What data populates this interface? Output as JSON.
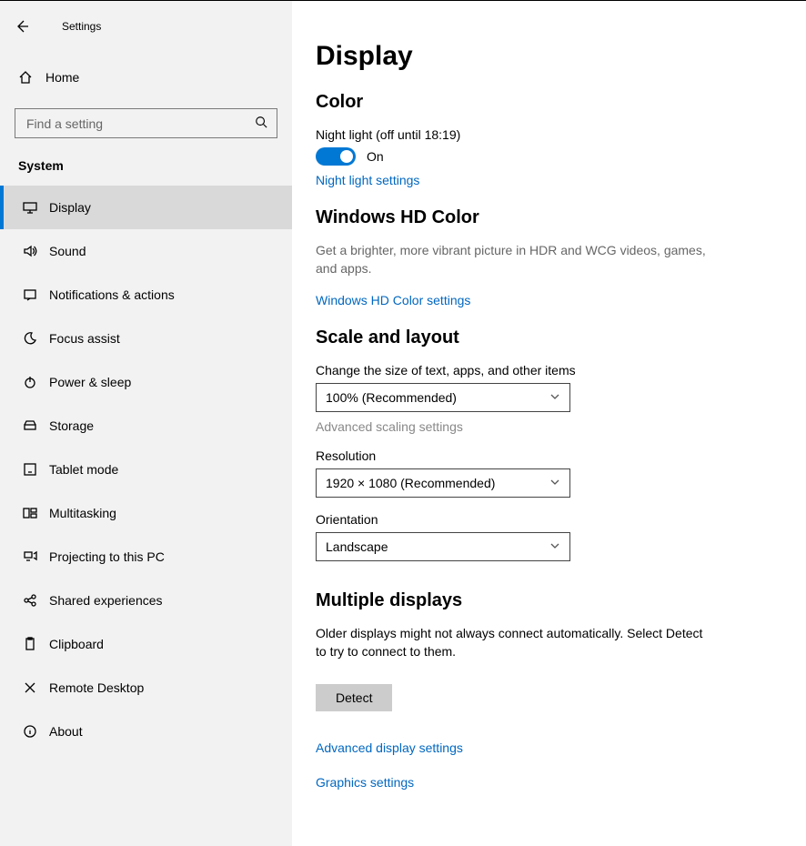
{
  "header": {
    "title": "Settings",
    "home": "Home",
    "search_placeholder": "Find a setting",
    "group": "System"
  },
  "nav": [
    {
      "label": "Display",
      "icon": "monitor"
    },
    {
      "label": "Sound",
      "icon": "sound"
    },
    {
      "label": "Notifications & actions",
      "icon": "notify"
    },
    {
      "label": "Focus assist",
      "icon": "moon"
    },
    {
      "label": "Power & sleep",
      "icon": "power"
    },
    {
      "label": "Storage",
      "icon": "storage"
    },
    {
      "label": "Tablet mode",
      "icon": "tablet"
    },
    {
      "label": "Multitasking",
      "icon": "multitask"
    },
    {
      "label": "Projecting to this PC",
      "icon": "project"
    },
    {
      "label": "Shared experiences",
      "icon": "shared"
    },
    {
      "label": "Clipboard",
      "icon": "clipboard"
    },
    {
      "label": "Remote Desktop",
      "icon": "remote"
    },
    {
      "label": "About",
      "icon": "about"
    }
  ],
  "page": {
    "title": "Display",
    "color": {
      "heading": "Color",
      "night_label": "Night light (off until 18:19)",
      "toggle_state": "On",
      "link": "Night light settings"
    },
    "hd": {
      "heading": "Windows HD Color",
      "desc": "Get a brighter, more vibrant picture in HDR and WCG videos, games, and apps.",
      "link": "Windows HD Color settings"
    },
    "scale": {
      "heading": "Scale and layout",
      "size_label": "Change the size of text, apps, and other items",
      "size_value": "100% (Recommended)",
      "adv_link": "Advanced scaling settings",
      "res_label": "Resolution",
      "res_value": "1920 × 1080 (Recommended)",
      "orient_label": "Orientation",
      "orient_value": "Landscape"
    },
    "multi": {
      "heading": "Multiple displays",
      "desc": "Older displays might not always connect automatically. Select Detect to try to connect to them.",
      "btn": "Detect",
      "adv_link": "Advanced display settings",
      "gfx_link": "Graphics settings"
    }
  }
}
